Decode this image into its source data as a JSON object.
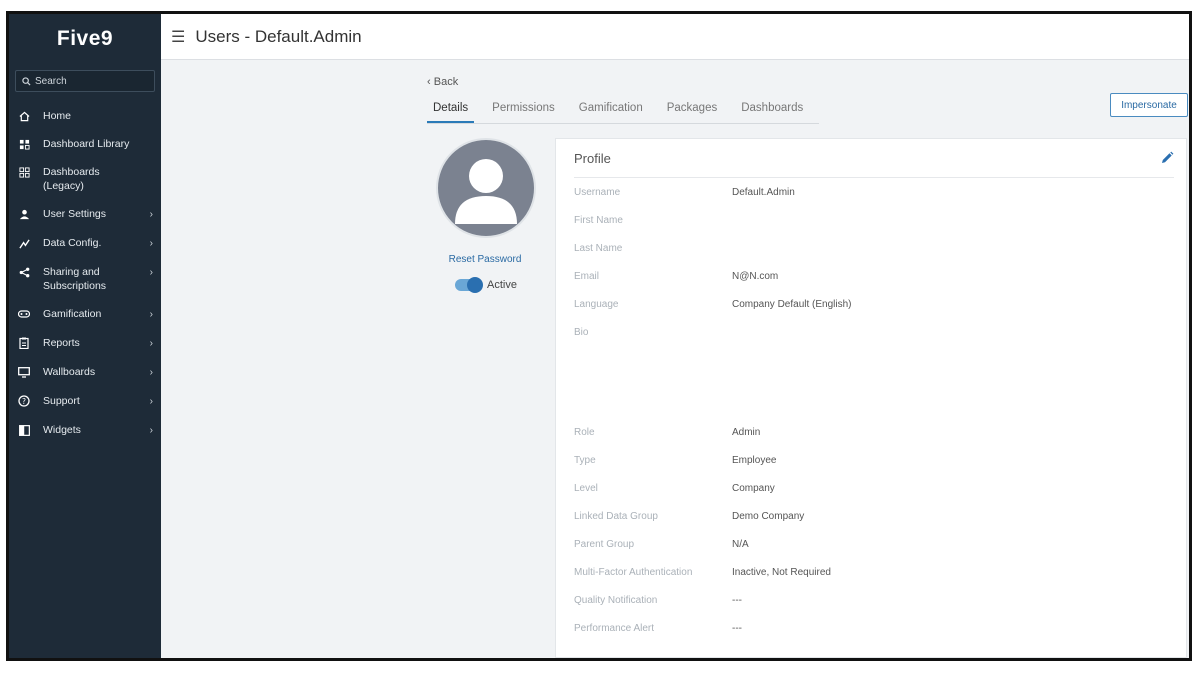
{
  "sidebar": {
    "logo": "Five9",
    "search_placeholder": "Search",
    "items": [
      {
        "label": "Home",
        "icon": "home-icon",
        "chevron": ""
      },
      {
        "label": "Dashboard Library",
        "icon": "dashboard-library-icon",
        "chevron": ""
      },
      {
        "label": "Dashboards (Legacy)",
        "icon": "dashboards-icon",
        "chevron": ""
      },
      {
        "label": "User Settings",
        "icon": "user-icon",
        "chevron": "›"
      },
      {
        "label": "Data Config.",
        "icon": "data-config-icon",
        "chevron": "›"
      },
      {
        "label": "Sharing and Subscriptions",
        "icon": "share-icon",
        "chevron": "›"
      },
      {
        "label": "Gamification",
        "icon": "gamepad-icon",
        "chevron": "›"
      },
      {
        "label": "Reports",
        "icon": "reports-icon",
        "chevron": "›"
      },
      {
        "label": "Wallboards",
        "icon": "monitor-icon",
        "chevron": "›"
      },
      {
        "label": "Support",
        "icon": "help-icon",
        "chevron": "›"
      },
      {
        "label": "Widgets",
        "icon": "widgets-icon",
        "chevron": "›"
      }
    ]
  },
  "header": {
    "title": "Users - Default.Admin"
  },
  "back_label": "Back",
  "tabs": [
    "Details",
    "Permissions",
    "Gamification",
    "Packages",
    "Dashboards"
  ],
  "impersonate_label": "Impersonate",
  "reset_password_label": "Reset Password",
  "status_label": "Active",
  "profile": {
    "title": "Profile",
    "fields": [
      {
        "label": "Username",
        "value": "Default.Admin"
      },
      {
        "label": "First Name",
        "value": ""
      },
      {
        "label": "Last Name",
        "value": ""
      },
      {
        "label": "Email",
        "value": "N@N.com"
      },
      {
        "label": "Language",
        "value": "Company Default (English)"
      },
      {
        "label": "Bio",
        "value": ""
      },
      {
        "label": "Role",
        "value": "Admin"
      },
      {
        "label": "Type",
        "value": "Employee"
      },
      {
        "label": "Level",
        "value": "Company"
      },
      {
        "label": "Linked Data Group",
        "value": "Demo Company"
      },
      {
        "label": "Parent Group",
        "value": "N/A"
      },
      {
        "label": "Multi-Factor Authentication",
        "value": "Inactive, Not Required"
      },
      {
        "label": "Quality Notification",
        "value": "---"
      },
      {
        "label": "Performance Alert",
        "value": "---"
      }
    ]
  },
  "colors": {
    "sidebar_bg": "#1e2b38",
    "accent": "#2a7ab8",
    "avatar_bg": "#7b8290"
  }
}
